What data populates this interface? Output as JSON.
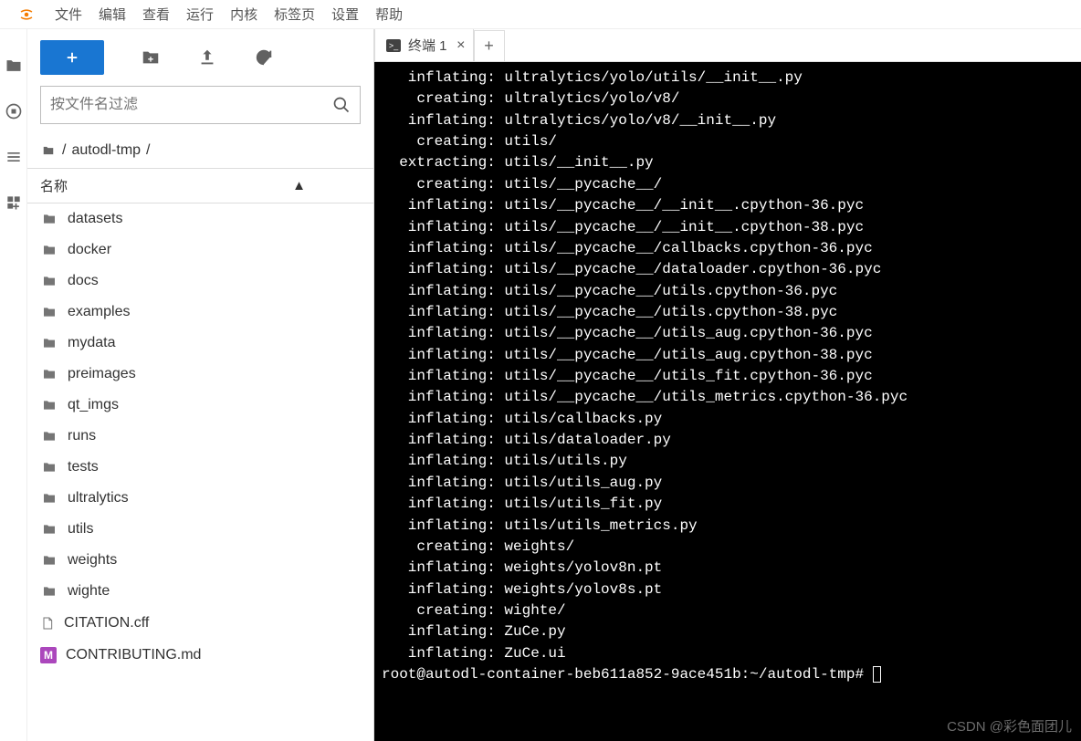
{
  "menu": {
    "items": [
      "文件",
      "编辑",
      "查看",
      "运行",
      "内核",
      "标签页",
      "设置",
      "帮助"
    ]
  },
  "toolbar": {
    "filter_placeholder": "按文件名过滤"
  },
  "breadcrumb": {
    "root": "/",
    "path": "autodl-tmp",
    "tail": "/"
  },
  "listhead": {
    "name": "名称",
    "sortglyph": "▲"
  },
  "files": [
    {
      "name": "datasets",
      "type": "folder"
    },
    {
      "name": "docker",
      "type": "folder"
    },
    {
      "name": "docs",
      "type": "folder"
    },
    {
      "name": "examples",
      "type": "folder"
    },
    {
      "name": "mydata",
      "type": "folder"
    },
    {
      "name": "preimages",
      "type": "folder"
    },
    {
      "name": "qt_imgs",
      "type": "folder"
    },
    {
      "name": "runs",
      "type": "folder"
    },
    {
      "name": "tests",
      "type": "folder"
    },
    {
      "name": "ultralytics",
      "type": "folder"
    },
    {
      "name": "utils",
      "type": "folder"
    },
    {
      "name": "weights",
      "type": "folder"
    },
    {
      "name": "wighte",
      "type": "folder"
    },
    {
      "name": "CITATION.cff",
      "type": "file"
    },
    {
      "name": "CONTRIBUTING.md",
      "type": "md"
    }
  ],
  "tabs": {
    "terminal_label": "终端 1",
    "terminal_icon": ">_"
  },
  "terminal_lines": [
    "   inflating: ultralytics/yolo/utils/__init__.py",
    "    creating: ultralytics/yolo/v8/",
    "   inflating: ultralytics/yolo/v8/__init__.py",
    "    creating: utils/",
    "  extracting: utils/__init__.py",
    "    creating: utils/__pycache__/",
    "   inflating: utils/__pycache__/__init__.cpython-36.pyc",
    "   inflating: utils/__pycache__/__init__.cpython-38.pyc",
    "   inflating: utils/__pycache__/callbacks.cpython-36.pyc",
    "   inflating: utils/__pycache__/dataloader.cpython-36.pyc",
    "   inflating: utils/__pycache__/utils.cpython-36.pyc",
    "   inflating: utils/__pycache__/utils.cpython-38.pyc",
    "   inflating: utils/__pycache__/utils_aug.cpython-36.pyc",
    "   inflating: utils/__pycache__/utils_aug.cpython-38.pyc",
    "   inflating: utils/__pycache__/utils_fit.cpython-36.pyc",
    "   inflating: utils/__pycache__/utils_metrics.cpython-36.pyc",
    "   inflating: utils/callbacks.py",
    "   inflating: utils/dataloader.py",
    "   inflating: utils/utils.py",
    "   inflating: utils/utils_aug.py",
    "   inflating: utils/utils_fit.py",
    "   inflating: utils/utils_metrics.py",
    "    creating: weights/",
    "   inflating: weights/yolov8n.pt",
    "   inflating: weights/yolov8s.pt",
    "    creating: wighte/",
    "   inflating: ZuCe.py",
    "   inflating: ZuCe.ui"
  ],
  "prompt": "root@autodl-container-beb611a852-9ace451b:~/autodl-tmp# ",
  "watermark": "CSDN @彩色面团儿"
}
